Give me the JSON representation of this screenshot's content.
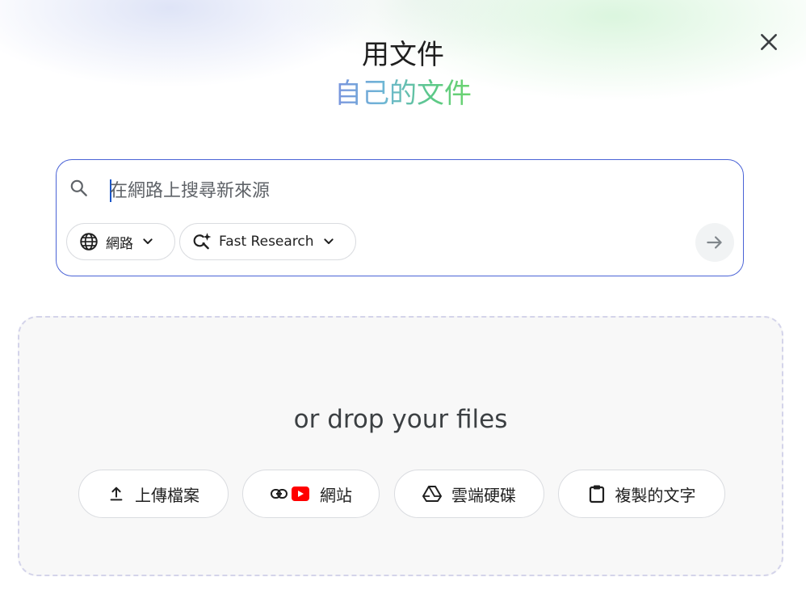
{
  "header": {
    "title": "用文件",
    "subtitle": "自己的文件"
  },
  "search": {
    "placeholder": "在網路上搜尋新來源",
    "value": "",
    "source_chip": {
      "label": "網路",
      "icon": "globe-icon"
    },
    "mode_chip": {
      "label": "Fast Research",
      "icon": "search-sparkle-icon"
    },
    "submit_icon": "arrow-right-icon"
  },
  "dropzone": {
    "text": "or drop your files",
    "actions": [
      {
        "label": "上傳檔案",
        "icon": "upload-icon"
      },
      {
        "label": "網站",
        "icon": "link-youtube-icon"
      },
      {
        "label": "雲端硬碟",
        "icon": "drive-icon"
      },
      {
        "label": "複製的文字",
        "icon": "clipboard-icon"
      }
    ]
  },
  "colors": {
    "accent_border": "#4a63d6",
    "youtube_red": "#ff0000",
    "gradient_start": "#7a93de",
    "gradient_end": "#6cd46e"
  }
}
